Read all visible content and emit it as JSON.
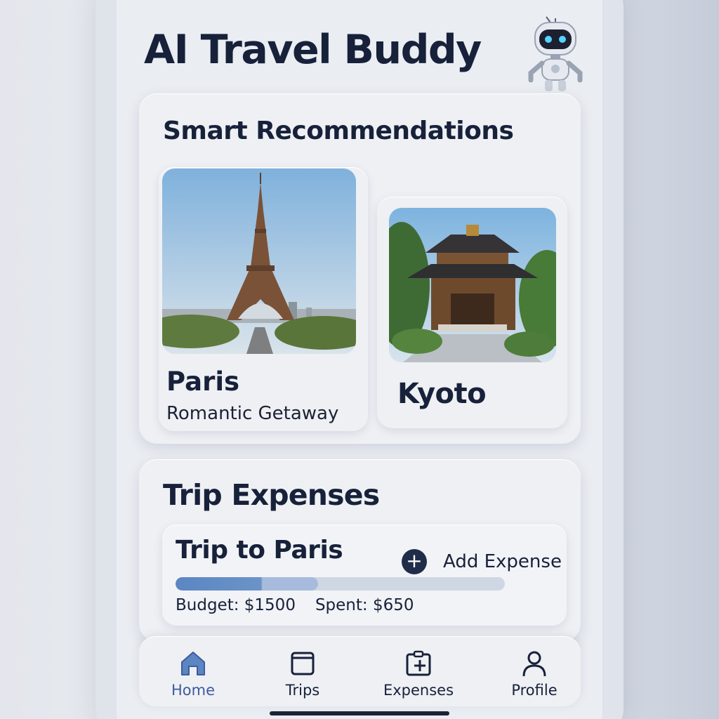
{
  "app": {
    "title": "AI Travel Buddy",
    "mascot_icon": "robot-icon"
  },
  "recommendations": {
    "title": "Smart Recommendations",
    "destinations": [
      {
        "name": "Paris",
        "subtitle": "Romantic Getaway",
        "image": "eiffel-tower-photo"
      },
      {
        "name": "Kyoto",
        "image": "kyoto-temple-photo"
      }
    ]
  },
  "expenses": {
    "title": "Trip Expenses",
    "trip": {
      "name": "Trip to Paris",
      "add_label": "Add Expense",
      "add_icon": "plus-icon",
      "budget": "Budget: $1500",
      "spent": "Spent: $650",
      "progress_fraction": 0.433
    }
  },
  "nav": {
    "items": [
      {
        "label": "Home",
        "icon": "home-icon",
        "active": true
      },
      {
        "label": "Trips",
        "icon": "calendar-icon",
        "active": false
      },
      {
        "label": "Expenses",
        "icon": "expense-clipboard-icon",
        "active": false
      },
      {
        "label": "Profile",
        "icon": "user-icon",
        "active": false
      }
    ]
  },
  "colors": {
    "accent": "#3f5aa0",
    "text": "#17213a",
    "progress": "#5b86c2"
  }
}
